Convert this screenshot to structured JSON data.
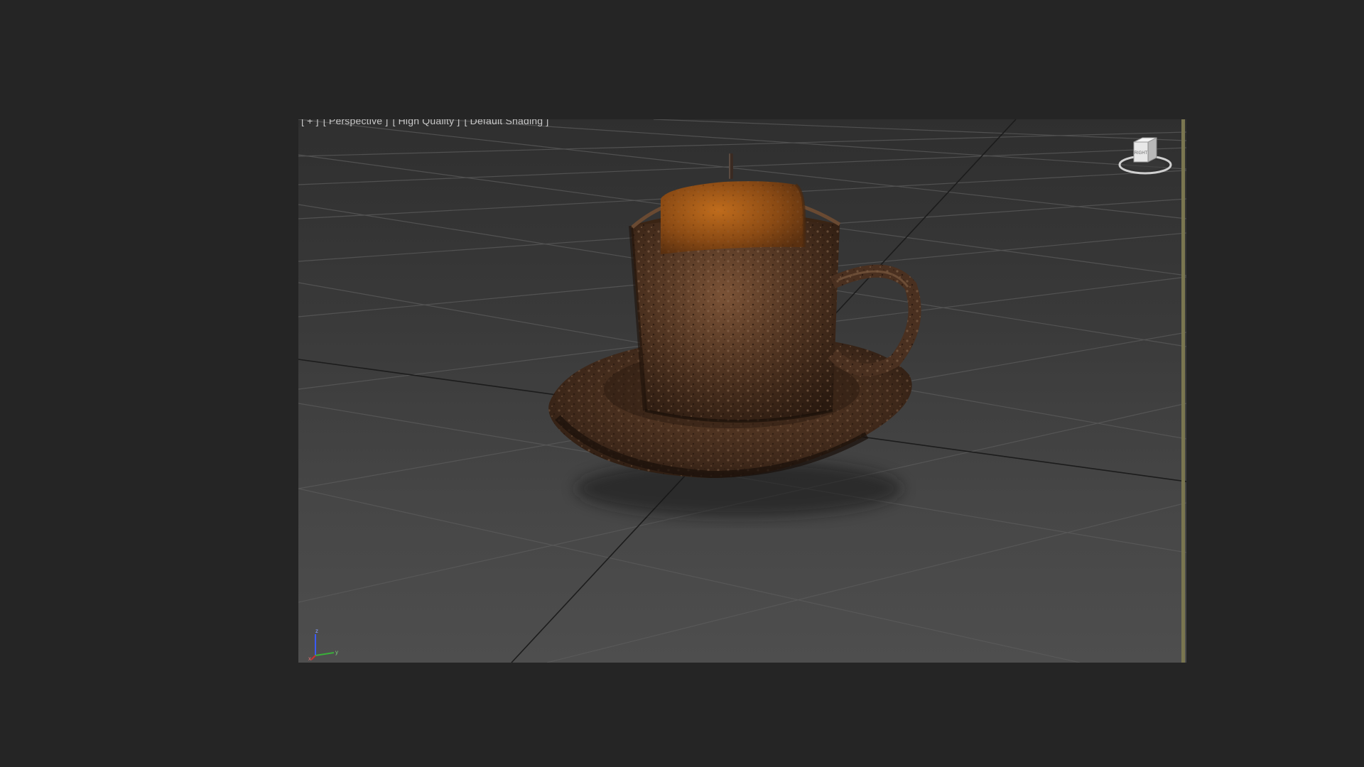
{
  "viewport": {
    "label_parts": [
      "[ + ]",
      "[ Perspective ]",
      "[ High Quality ]",
      "[ Default Shading ]"
    ],
    "viewcube_face": "RIGHT",
    "axis_labels": {
      "x": "x",
      "y": "y",
      "z": "z"
    }
  },
  "colors": {
    "app_background": "#252525",
    "viewport_border": "#7a7650",
    "grid_line": "#5a5a5a",
    "grid_axis": "#1a1a1a",
    "cup_body": "#5a3a24",
    "candle_wax": "#a05a18"
  },
  "scene_objects": [
    "saucer",
    "cup",
    "handle",
    "candle",
    "wick"
  ]
}
